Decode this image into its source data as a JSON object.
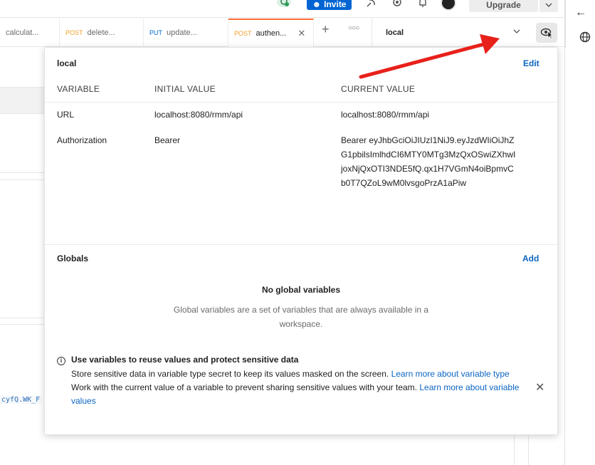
{
  "topbar": {
    "invite_label": "Invite",
    "upgrade_label": "Upgrade"
  },
  "tabs": [
    {
      "method": "",
      "label": "calculat..."
    },
    {
      "method": "POST",
      "label": "delete..."
    },
    {
      "method": "PUT",
      "label": "update..."
    },
    {
      "method": "POST",
      "label": "authen..."
    }
  ],
  "environment": {
    "selected": "local"
  },
  "popup": {
    "env_name": "local",
    "edit_label": "Edit",
    "headers": {
      "variable": "VARIABLE",
      "initial": "INITIAL VALUE",
      "current": "CURRENT VALUE"
    },
    "rows": [
      {
        "name": "URL",
        "initial": "localhost:8080/rmm/api",
        "current": "localhost:8080/rmm/api"
      },
      {
        "name": "Authorization",
        "initial": "Bearer",
        "current": "Bearer eyJhbGciOiJIUzI1NiJ9.eyJzdWIiOiJhZG1pbilsImlhdCI6MTY0MTg3MzQxOSwiZXhwIjoxNjQxOTI3NDE5fQ.qx1H7VGmN4oiBpmvCb0T7QZoL9wM0lvsgoPrzA1aPiw"
      }
    ],
    "globals_title": "Globals",
    "add_label": "Add",
    "no_globals": "No global variables",
    "no_globals_desc": "Global variables are a set of variables that are always available in a workspace.",
    "info_title": "Use variables to reuse values and protect sensitive data",
    "info_line1": "Store sensitive data in variable type secret to keep its values masked on the screen. ",
    "info_link1": "Learn more about variable type",
    "info_line2": "Work with the current value of a variable to prevent sharing sensitive values with your team. ",
    "info_link2": "Learn more about variable values"
  },
  "background": {
    "code_snippet": "cyfQ.WK_F"
  },
  "colors": {
    "accent_blue": "#0265d2",
    "link_blue": "#0b65c2",
    "post": "#f0a029",
    "put": "#0069d1",
    "arrow_red": "#e8201a"
  }
}
